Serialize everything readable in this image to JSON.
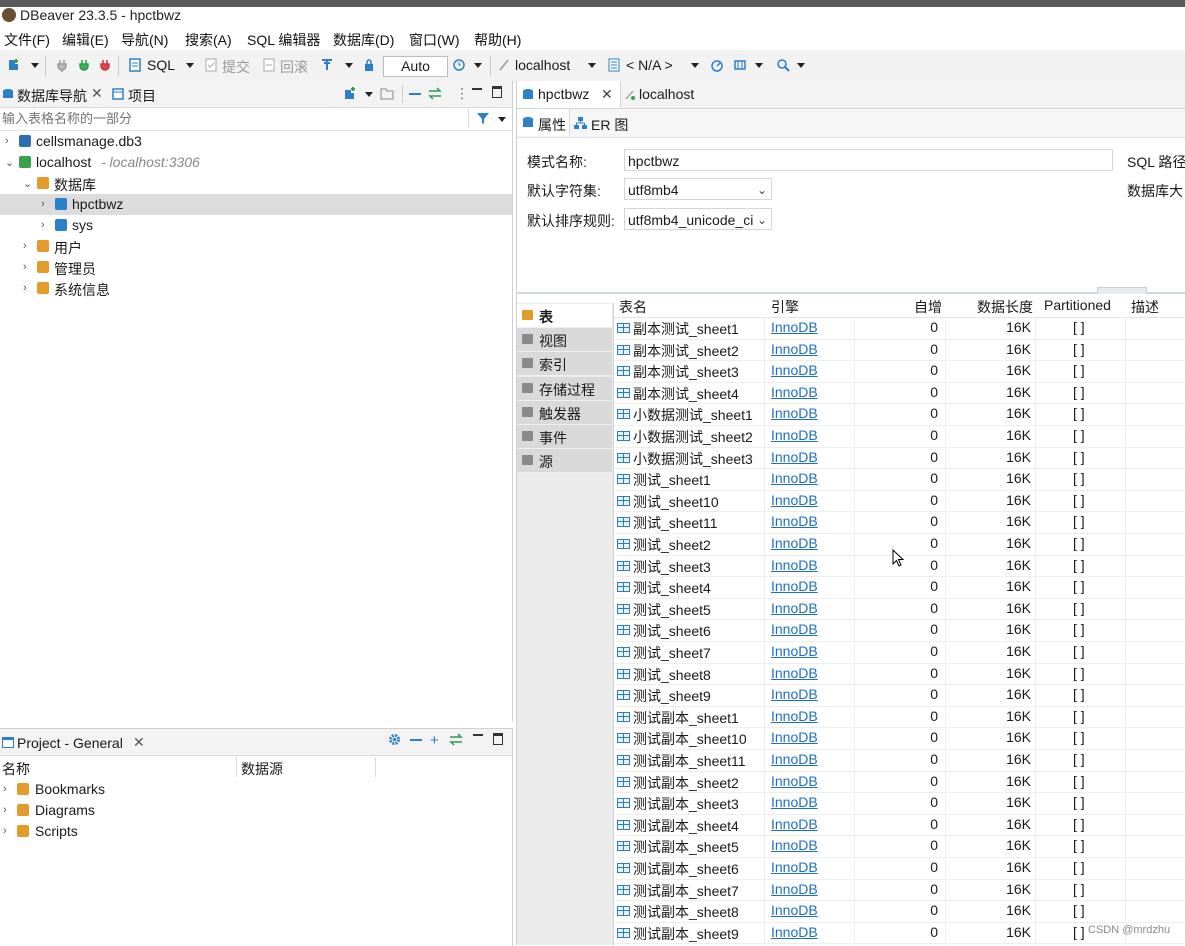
{
  "window": {
    "title": "DBeaver 23.3.5 - hpctbwz"
  },
  "menubar": [
    "文件(F)",
    "编辑(E)",
    "导航(N)",
    "搜索(A)",
    "SQL 编辑器",
    "数据库(D)",
    "窗口(W)",
    "帮助(H)"
  ],
  "toolbar": {
    "sql_label": "SQL",
    "commit_label": "提交",
    "rollback_label": "回滚",
    "tx_mode": "Auto",
    "datasource": "localhost",
    "schema": "< N/A >"
  },
  "navigator": {
    "tab_label": "数据库导航",
    "projects_tab_label": "项目",
    "filter_placeholder": "输入表格名称的一部分",
    "tree": [
      {
        "label": "cellsmanage.db3",
        "sub": "",
        "level": 0,
        "expanded": false,
        "icon": "sqlite-db-icon",
        "color": "#2d6fb0"
      },
      {
        "label": "localhost",
        "sub": " - localhost:3306",
        "level": 0,
        "expanded": true,
        "icon": "mysql-connection-icon",
        "color": "#3aa04a"
      },
      {
        "label": "数据库",
        "sub": "",
        "level": 1,
        "expanded": true,
        "icon": "folder-icon",
        "color": "#e39b2a"
      },
      {
        "label": "hpctbwz",
        "sub": "",
        "level": 2,
        "expanded": false,
        "icon": "database-icon",
        "color": "#2c7fc9",
        "selected": true
      },
      {
        "label": "sys",
        "sub": "",
        "level": 2,
        "expanded": false,
        "icon": "database-icon",
        "color": "#2c7fc9"
      },
      {
        "label": "用户",
        "sub": "",
        "level": 1,
        "expanded": false,
        "icon": "users-folder-icon",
        "color": "#e39b2a"
      },
      {
        "label": "管理员",
        "sub": "",
        "level": 1,
        "expanded": false,
        "icon": "admin-folder-icon",
        "color": "#e39b2a"
      },
      {
        "label": "系统信息",
        "sub": "",
        "level": 1,
        "expanded": false,
        "icon": "sysinfo-folder-icon",
        "color": "#e39b2a"
      }
    ]
  },
  "project": {
    "tab_label": "Project - General",
    "col_name": "名称",
    "col_datasource": "数据源",
    "items": [
      "Bookmarks",
      "Diagrams",
      "Scripts"
    ]
  },
  "editor": {
    "tabs": [
      "hpctbwz",
      "localhost"
    ],
    "subtabs": [
      "属性",
      "ER 图"
    ],
    "props": {
      "schema_name_label": "模式名称:",
      "schema_name": "hpctbwz",
      "charset_label": "默认字符集:",
      "charset": "utf8mb4",
      "collation_label": "默认排序规则:",
      "collation": "utf8mb4_unicode_ci",
      "sql_path_label": "SQL 路径:",
      "db_size_label": "数据库大"
    },
    "side_tabs": [
      "表",
      "视图",
      "索引",
      "存储过程",
      "触发器",
      "事件",
      "源"
    ],
    "columns": [
      "表名",
      "引擎",
      "自增",
      "数据长度",
      "Partitioned",
      "描述"
    ],
    "rows": [
      [
        "副本测试_sheet1",
        "InnoDB",
        "0",
        "16K",
        "[ ]",
        ""
      ],
      [
        "副本测试_sheet2",
        "InnoDB",
        "0",
        "16K",
        "[ ]",
        ""
      ],
      [
        "副本测试_sheet3",
        "InnoDB",
        "0",
        "16K",
        "[ ]",
        ""
      ],
      [
        "副本测试_sheet4",
        "InnoDB",
        "0",
        "16K",
        "[ ]",
        ""
      ],
      [
        "小数据测试_sheet1",
        "InnoDB",
        "0",
        "16K",
        "[ ]",
        ""
      ],
      [
        "小数据测试_sheet2",
        "InnoDB",
        "0",
        "16K",
        "[ ]",
        ""
      ],
      [
        "小数据测试_sheet3",
        "InnoDB",
        "0",
        "16K",
        "[ ]",
        ""
      ],
      [
        "测试_sheet1",
        "InnoDB",
        "0",
        "16K",
        "[ ]",
        ""
      ],
      [
        "测试_sheet10",
        "InnoDB",
        "0",
        "16K",
        "[ ]",
        ""
      ],
      [
        "测试_sheet11",
        "InnoDB",
        "0",
        "16K",
        "[ ]",
        ""
      ],
      [
        "测试_sheet2",
        "InnoDB",
        "0",
        "16K",
        "[ ]",
        ""
      ],
      [
        "测试_sheet3",
        "InnoDB",
        "0",
        "16K",
        "[ ]",
        ""
      ],
      [
        "测试_sheet4",
        "InnoDB",
        "0",
        "16K",
        "[ ]",
        ""
      ],
      [
        "测试_sheet5",
        "InnoDB",
        "0",
        "16K",
        "[ ]",
        ""
      ],
      [
        "测试_sheet6",
        "InnoDB",
        "0",
        "16K",
        "[ ]",
        ""
      ],
      [
        "测试_sheet7",
        "InnoDB",
        "0",
        "16K",
        "[ ]",
        ""
      ],
      [
        "测试_sheet8",
        "InnoDB",
        "0",
        "16K",
        "[ ]",
        ""
      ],
      [
        "测试_sheet9",
        "InnoDB",
        "0",
        "16K",
        "[ ]",
        ""
      ],
      [
        "测试副本_sheet1",
        "InnoDB",
        "0",
        "16K",
        "[ ]",
        ""
      ],
      [
        "测试副本_sheet10",
        "InnoDB",
        "0",
        "16K",
        "[ ]",
        ""
      ],
      [
        "测试副本_sheet11",
        "InnoDB",
        "0",
        "16K",
        "[ ]",
        ""
      ],
      [
        "测试副本_sheet2",
        "InnoDB",
        "0",
        "16K",
        "[ ]",
        ""
      ],
      [
        "测试副本_sheet3",
        "InnoDB",
        "0",
        "16K",
        "[ ]",
        ""
      ],
      [
        "测试副本_sheet4",
        "InnoDB",
        "0",
        "16K",
        "[ ]",
        ""
      ],
      [
        "测试副本_sheet5",
        "InnoDB",
        "0",
        "16K",
        "[ ]",
        ""
      ],
      [
        "测试副本_sheet6",
        "InnoDB",
        "0",
        "16K",
        "[ ]",
        ""
      ],
      [
        "测试副本_sheet7",
        "InnoDB",
        "0",
        "16K",
        "[ ]",
        ""
      ],
      [
        "测试副本_sheet8",
        "InnoDB",
        "0",
        "16K",
        "[ ]",
        ""
      ],
      [
        "测试副本_sheet9",
        "InnoDB",
        "0",
        "16K",
        "[ ]",
        ""
      ]
    ]
  },
  "watermark": "CSDN @mrdzhu",
  "colors": {
    "accent": "#1d6fc4",
    "selection": "#dcdcdc"
  }
}
